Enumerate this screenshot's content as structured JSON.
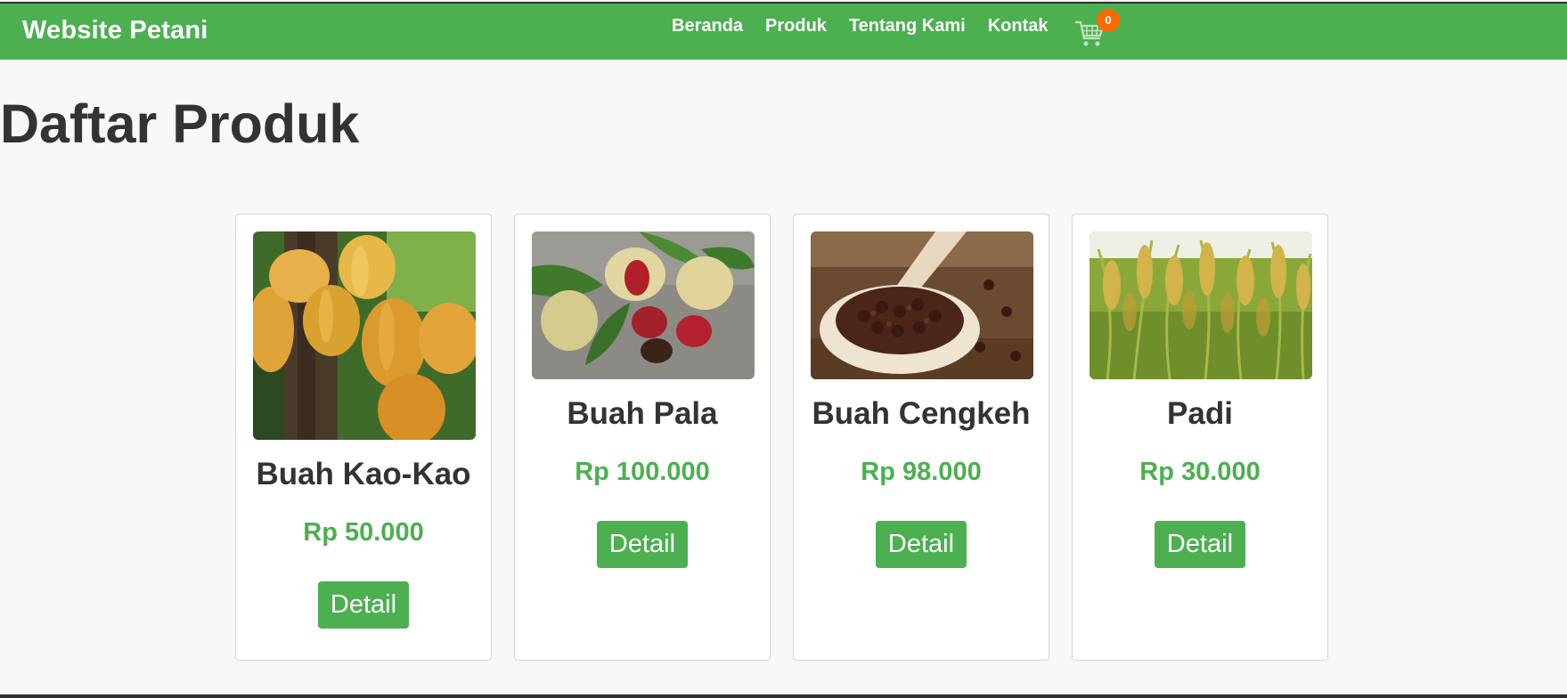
{
  "header": {
    "brand": "Website Petani",
    "nav": [
      {
        "label": "Beranda"
      },
      {
        "label": "Produk"
      },
      {
        "label": "Tentang Kami"
      },
      {
        "label": "Kontak"
      }
    ],
    "cart_count": "0"
  },
  "main": {
    "title": "Daftar Produk",
    "products": [
      {
        "name": "Buah Kao-Kao",
        "price": "Rp 50.000",
        "button": "Detail",
        "image": "cacao-pods-image"
      },
      {
        "name": "Buah Pala",
        "price": "Rp 100.000",
        "button": "Detail",
        "image": "nutmeg-image"
      },
      {
        "name": "Buah Cengkeh",
        "price": "Rp 98.000",
        "button": "Detail",
        "image": "cloves-image"
      },
      {
        "name": "Padi",
        "price": "Rp 30.000",
        "button": "Detail",
        "image": "rice-plant-image"
      }
    ]
  },
  "colors": {
    "primary": "#4caf50",
    "badge": "#ff6a00",
    "text": "#333333",
    "background": "#f8f8f8"
  }
}
